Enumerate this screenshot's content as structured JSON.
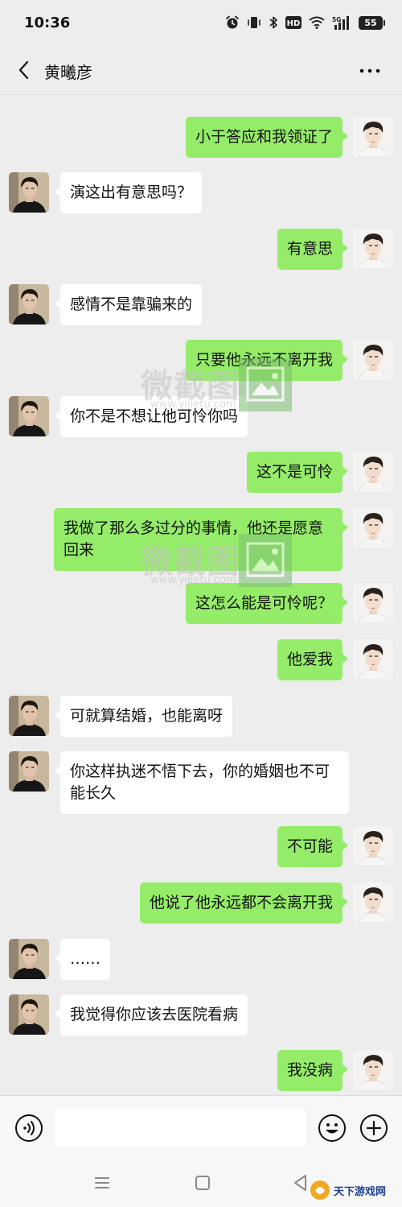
{
  "status_bar": {
    "time": "10:36",
    "network_label": "5G",
    "battery": "55"
  },
  "header": {
    "title": "黄曦彦"
  },
  "messages": [
    {
      "from": "me",
      "text": "小于答应和我领证了"
    },
    {
      "from": "other",
      "text": "演这出有意思吗？"
    },
    {
      "from": "me",
      "text": "有意思"
    },
    {
      "from": "other",
      "text": "感情不是靠骗来的"
    },
    {
      "from": "me",
      "text": "只要他永远不离开我"
    },
    {
      "from": "other",
      "text": "你不是不想让他可怜你吗"
    },
    {
      "from": "me",
      "text": "这不是可怜"
    },
    {
      "from": "me",
      "text": "我做了那么多过分的事情，他还是愿意回来"
    },
    {
      "from": "me",
      "text": "这怎么能是可怜呢？"
    },
    {
      "from": "me",
      "text": "他爱我"
    },
    {
      "from": "other",
      "text": "可就算结婚，也能离呀"
    },
    {
      "from": "other",
      "text": "你这样执迷不悟下去，你的婚姻也不可能长久"
    },
    {
      "from": "me",
      "text": "不可能"
    },
    {
      "from": "me",
      "text": "他说了他永远都不会离开我"
    },
    {
      "from": "other",
      "text": "……"
    },
    {
      "from": "other",
      "text": "我觉得你应该去医院看病"
    },
    {
      "from": "me",
      "text": "我没病"
    }
  ],
  "watermarks": [
    {
      "text": "微截图",
      "url": "www.yijietu.com"
    },
    {
      "text": "微截图",
      "url": "www.yijietu.com"
    }
  ],
  "input_bar": {
    "value": "",
    "placeholder": ""
  },
  "corner_logo": {
    "text": "天下游戏网"
  },
  "icons": {
    "back": "chevron-left-icon",
    "more": "more-dots-icon",
    "voice": "voice-icon",
    "emoji": "emoji-icon",
    "plus": "plus-icon"
  },
  "colors": {
    "my_bubble": "#95ec69",
    "other_bubble": "#ffffff",
    "background": "#ededed"
  }
}
